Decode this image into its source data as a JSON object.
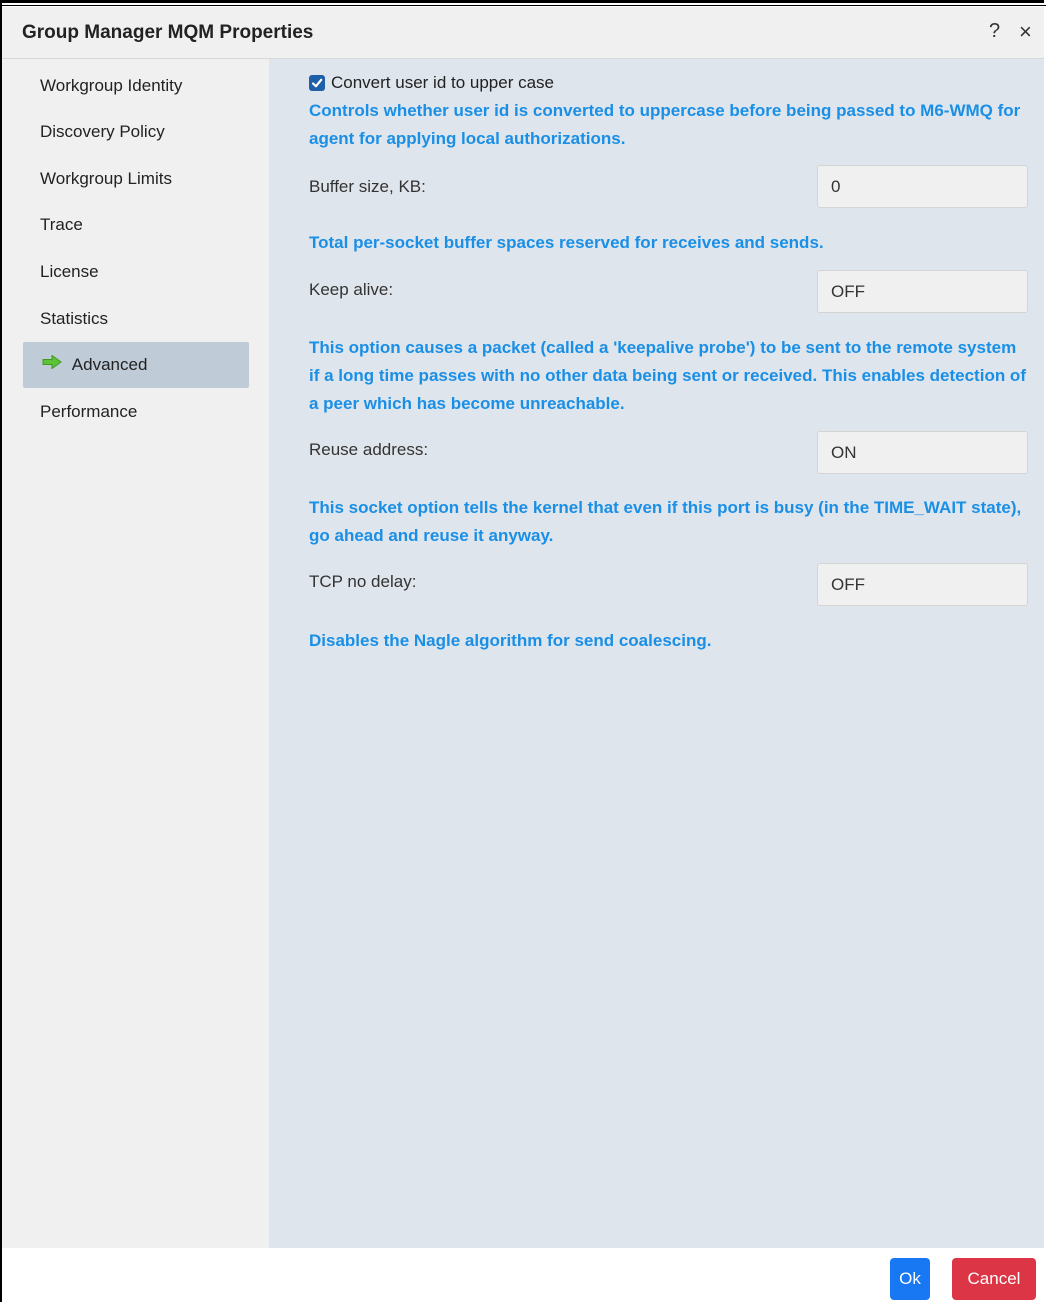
{
  "window": {
    "title": "Group Manager MQM Properties",
    "help_label": "?",
    "close_label": "×"
  },
  "sidebar": {
    "items": [
      {
        "label": "Workgroup Identity"
      },
      {
        "label": "Discovery Policy"
      },
      {
        "label": "Workgroup Limits"
      },
      {
        "label": "Trace"
      },
      {
        "label": "License"
      },
      {
        "label": "Statistics"
      },
      {
        "label": "Advanced",
        "selected": true,
        "icon": "green-arrow-right-icon"
      },
      {
        "label": "Performance"
      }
    ]
  },
  "advanced": {
    "convert_uid": {
      "label": "Convert user id to upper case",
      "checked": true,
      "description": "Controls whether user id is converted to uppercase before being passed to M6-WMQ for agent for applying local authorizations."
    },
    "buffer_size": {
      "label": "Buffer size, KB:",
      "value": "0",
      "description": "Total per-socket buffer spaces reserved for receives and sends."
    },
    "keep_alive": {
      "label": "Keep alive:",
      "value": "OFF",
      "description": "This option causes a packet (called a 'keepalive probe') to be sent to the remote system if a long time passes with no other data being sent or received. This enables detection of a peer which has become unreachable."
    },
    "reuse_address": {
      "label": "Reuse address:",
      "value": "ON",
      "description": "This socket option tells the kernel that even if this port is busy (in the TIME_WAIT state), go ahead and reuse it anyway."
    },
    "tcp_no_delay": {
      "label": "TCP no delay:",
      "value": "OFF",
      "description": "Disables the Nagle algorithm for send coalescing."
    }
  },
  "footer": {
    "ok_label": "Ok",
    "cancel_label": "Cancel"
  },
  "colors": {
    "accent_text": "#1a8fe6",
    "ok_button": "#1877f2",
    "cancel_button": "#dc3545",
    "selected_nav": "#bfcbd6",
    "content_bg": "#dfe5ec"
  }
}
